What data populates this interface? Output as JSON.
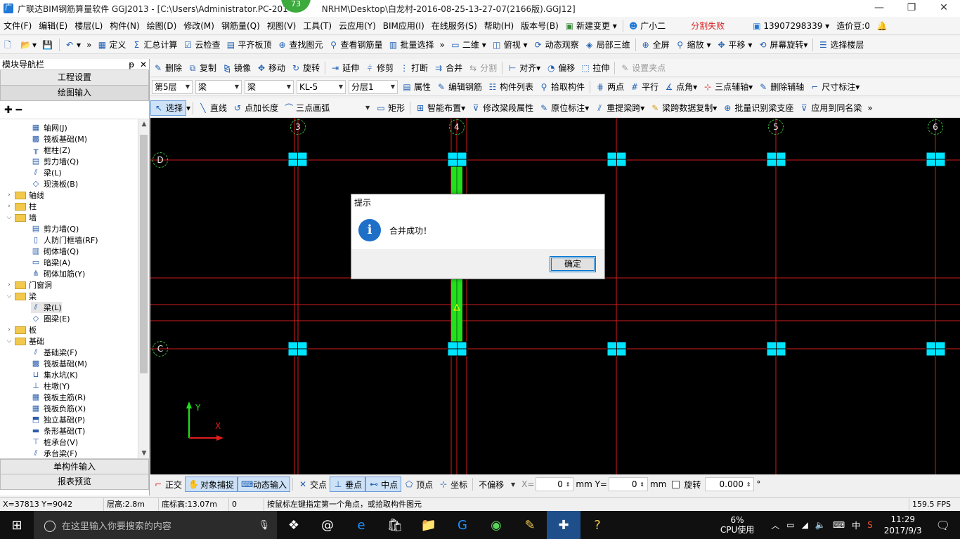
{
  "window": {
    "app_icon": "app-icon",
    "title": "广联达BIM钢筋算量软件 GGJ2013 - [C:\\Users\\Administrator.PC-201",
    "title_tail": "NRHM\\Desktop\\白龙村-2016-08-25-13-27-07(2166版).GGJ12]",
    "badge": "73",
    "min": "—",
    "restore": "❐",
    "close": "✕"
  },
  "menu": {
    "items": [
      "文件(F)",
      "编辑(E)",
      "楼层(L)",
      "构件(N)",
      "绘图(D)",
      "修改(M)",
      "钢筋量(Q)",
      "视图(V)",
      "工具(T)",
      "云应用(Y)",
      "BIM应用(I)",
      "在线服务(S)",
      "帮助(H)",
      "版本号(B)"
    ],
    "change": "新建变更",
    "assistant": "广小二",
    "split_status": "分割失败",
    "phone": "13907298339",
    "cost": "造价豆:0"
  },
  "toolbar1": {
    "items": [
      "定义",
      "汇总计算",
      "云检查",
      "平齐板顶",
      "查找图元",
      "查看钢筋量",
      "批量选择",
      "二维",
      "俯视",
      "动态观察",
      "局部三维",
      "全屏",
      "缩放",
      "平移",
      "屏幕旋转",
      "选择楼层"
    ]
  },
  "toolbar2": {
    "items": [
      "删除",
      "复制",
      "镜像",
      "移动",
      "旋转",
      "延伸",
      "修剪",
      "打断",
      "合并",
      "分割",
      "对齐",
      "偏移",
      "拉伸",
      "设置夹点"
    ]
  },
  "toolbar3": {
    "floor": "第5层",
    "type1": "梁",
    "type2": "梁",
    "component": "KL-5",
    "layer": "分层1",
    "items": [
      "属性",
      "编辑钢筋",
      "构件列表",
      "拾取构件",
      "两点",
      "平行",
      "点角",
      "三点辅轴",
      "删除辅轴",
      "尺寸标注"
    ]
  },
  "toolbar4": {
    "items": [
      "选择",
      "直线",
      "点加长度",
      "三点画弧",
      "矩形",
      "智能布置",
      "修改梁段属性",
      "原位标注",
      "重提梁跨",
      "梁跨数据复制",
      "批量识别梁支座",
      "应用到同名梁"
    ]
  },
  "nav": {
    "title": "模块导航栏",
    "pin": "ᵽ",
    "close": "✕",
    "btn_engineering": "工程设置",
    "btn_drawing": "绘图输入",
    "btn_single": "单构件输入",
    "btn_report": "报表预览",
    "tree": [
      {
        "label": "轴网(J)",
        "level": 2,
        "icon": "grid-icon"
      },
      {
        "label": "筏板基础(M)",
        "level": 2,
        "icon": "raft-icon"
      },
      {
        "label": "框柱(Z)",
        "level": 2,
        "icon": "column-icon"
      },
      {
        "label": "剪力墙(Q)",
        "level": 2,
        "icon": "wall-icon"
      },
      {
        "label": "梁(L)",
        "level": 2,
        "icon": "beam-icon"
      },
      {
        "label": "现浇板(B)",
        "level": 2,
        "icon": "slab-icon"
      },
      {
        "label": "轴线",
        "level": 1,
        "folder": true,
        "open": false
      },
      {
        "label": "柱",
        "level": 1,
        "folder": true,
        "open": false
      },
      {
        "label": "墙",
        "level": 1,
        "folder": true,
        "open": true
      },
      {
        "label": "剪力墙(Q)",
        "level": 2,
        "icon": "wall-icon"
      },
      {
        "label": "人防门框墙(RF)",
        "level": 2,
        "icon": "door-wall-icon"
      },
      {
        "label": "砌体墙(Q)",
        "level": 2,
        "icon": "masonry-icon"
      },
      {
        "label": "暗梁(A)",
        "level": 2,
        "icon": "hidden-beam-icon"
      },
      {
        "label": "砌体加筋(Y)",
        "level": 2,
        "icon": "rebar-icon"
      },
      {
        "label": "门窗洞",
        "level": 1,
        "folder": true,
        "open": false
      },
      {
        "label": "梁",
        "level": 1,
        "folder": true,
        "open": true
      },
      {
        "label": "梁(L)",
        "level": 2,
        "icon": "beam-icon",
        "selected": true
      },
      {
        "label": "圈梁(E)",
        "level": 2,
        "icon": "ring-beam-icon"
      },
      {
        "label": "板",
        "level": 1,
        "folder": true,
        "open": false
      },
      {
        "label": "基础",
        "level": 1,
        "folder": true,
        "open": true
      },
      {
        "label": "基础梁(F)",
        "level": 2,
        "icon": "foundation-beam-icon"
      },
      {
        "label": "筏板基础(M)",
        "level": 2,
        "icon": "raft-icon"
      },
      {
        "label": "集水坑(K)",
        "level": 2,
        "icon": "sump-icon"
      },
      {
        "label": "柱墩(Y)",
        "level": 2,
        "icon": "pier-icon"
      },
      {
        "label": "筏板主筋(R)",
        "level": 2,
        "icon": "main-rebar-icon"
      },
      {
        "label": "筏板负筋(X)",
        "level": 2,
        "icon": "neg-rebar-icon"
      },
      {
        "label": "独立基础(P)",
        "level": 2,
        "icon": "isolated-footing-icon"
      },
      {
        "label": "条形基础(T)",
        "level": 2,
        "icon": "strip-footing-icon"
      },
      {
        "label": "桩承台(V)",
        "level": 2,
        "icon": "pile-cap-icon"
      },
      {
        "label": "承台梁(F)",
        "level": 2,
        "icon": "cap-beam-icon"
      }
    ]
  },
  "canvas": {
    "axes_top": [
      "3",
      "4",
      "5",
      "6"
    ],
    "axes_left": [
      "D",
      "C"
    ],
    "ucs_y": "Y",
    "ucs_x": "X"
  },
  "dialog": {
    "title": "提示",
    "icon": "i",
    "message": "合并成功！",
    "ok": "确定"
  },
  "snap": {
    "ortho": "正交",
    "osnap": "对象捕捉",
    "dynamic": "动态输入",
    "intersection": "交点",
    "perpendicular": "垂点",
    "midpoint": "中点",
    "vertex": "顶点",
    "coordinate": "坐标",
    "offset_mode": "不偏移",
    "x_label": "X=",
    "x_value": "0",
    "y_label": "mm Y=",
    "y_value": "0",
    "unit": "mm",
    "rotate": "旋转",
    "rotate_value": "0.000",
    "degree": "°"
  },
  "status": {
    "coords": "X=37813 Y=9042",
    "floor_height": "层高:2.8m",
    "bottom_elev": "底标高:13.07m",
    "zero": "0",
    "hint": "按鼠标左键指定第一个角点，或拾取构件图元",
    "fps": "159.5 FPS"
  },
  "taskbar": {
    "search_placeholder": "在这里输入你要搜索的内容",
    "cpu": "6%",
    "cpu_label": "CPU使用",
    "ime": "中",
    "time": "11:29",
    "date": "2017/9/3"
  },
  "colors": {
    "grid_line": "#d21c1c",
    "column": "#00e5ff",
    "beam": "#22e01c",
    "axis_bubble": "#3fbf3f"
  }
}
